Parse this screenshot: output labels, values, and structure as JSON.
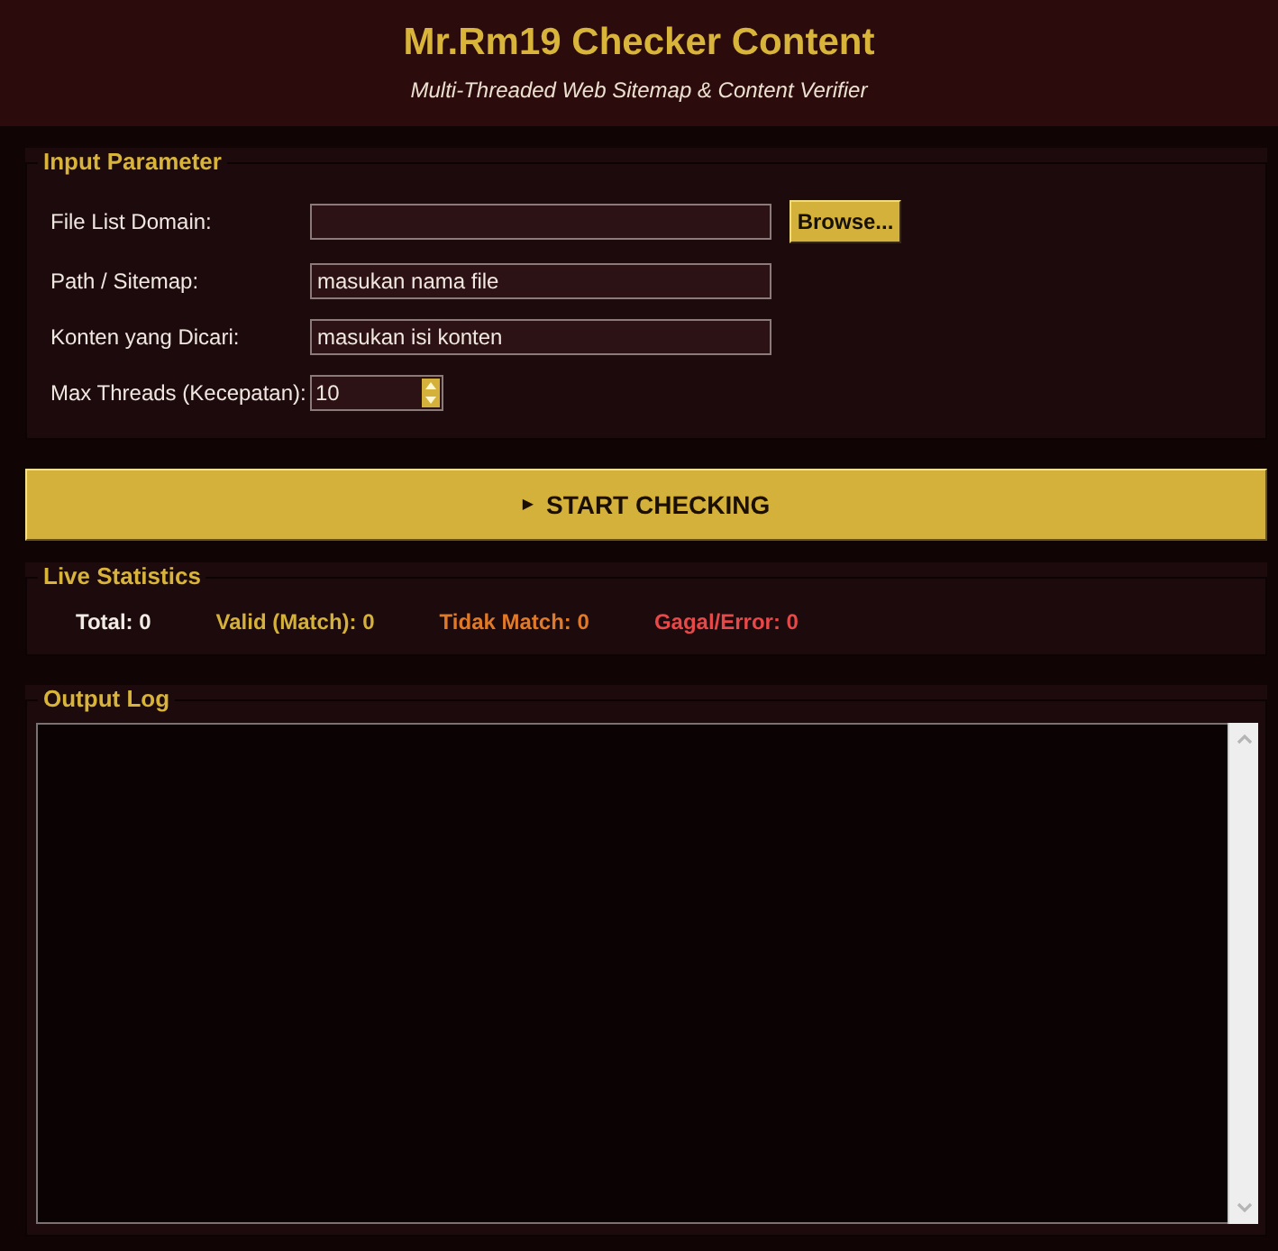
{
  "header": {
    "title": "Mr.Rm19 Checker Content",
    "subtitle": "Multi-Threaded Web Sitemap & Content Verifier"
  },
  "input_parameter": {
    "title": "Input Parameter",
    "fields": [
      {
        "kind": "file",
        "label": "File List Domain:",
        "button": "Browse..."
      },
      {
        "kind": "text",
        "label": "Path / Sitemap:",
        "value": "masukan nama file"
      },
      {
        "kind": "text",
        "label": "Konten yang Dicari:",
        "value": "masukan isi konten"
      },
      {
        "kind": "spin",
        "label": "Max Threads (Kecepatan):",
        "value": "10"
      }
    ]
  },
  "start_button": {
    "icon": "▶",
    "label": "START CHECKING"
  },
  "live_statistics": {
    "title": "Live Statistics",
    "items": [
      {
        "text": "Total: 0",
        "color": "#f2ece4"
      },
      {
        "text": "Valid (Match): 0",
        "color": "#d4b13a"
      },
      {
        "text": "Tidak Match: 0",
        "color": "#e07a28"
      },
      {
        "text": "Gagal/Error: 0",
        "color": "#e84848"
      }
    ]
  },
  "output_log": {
    "title": "Output Log"
  }
}
